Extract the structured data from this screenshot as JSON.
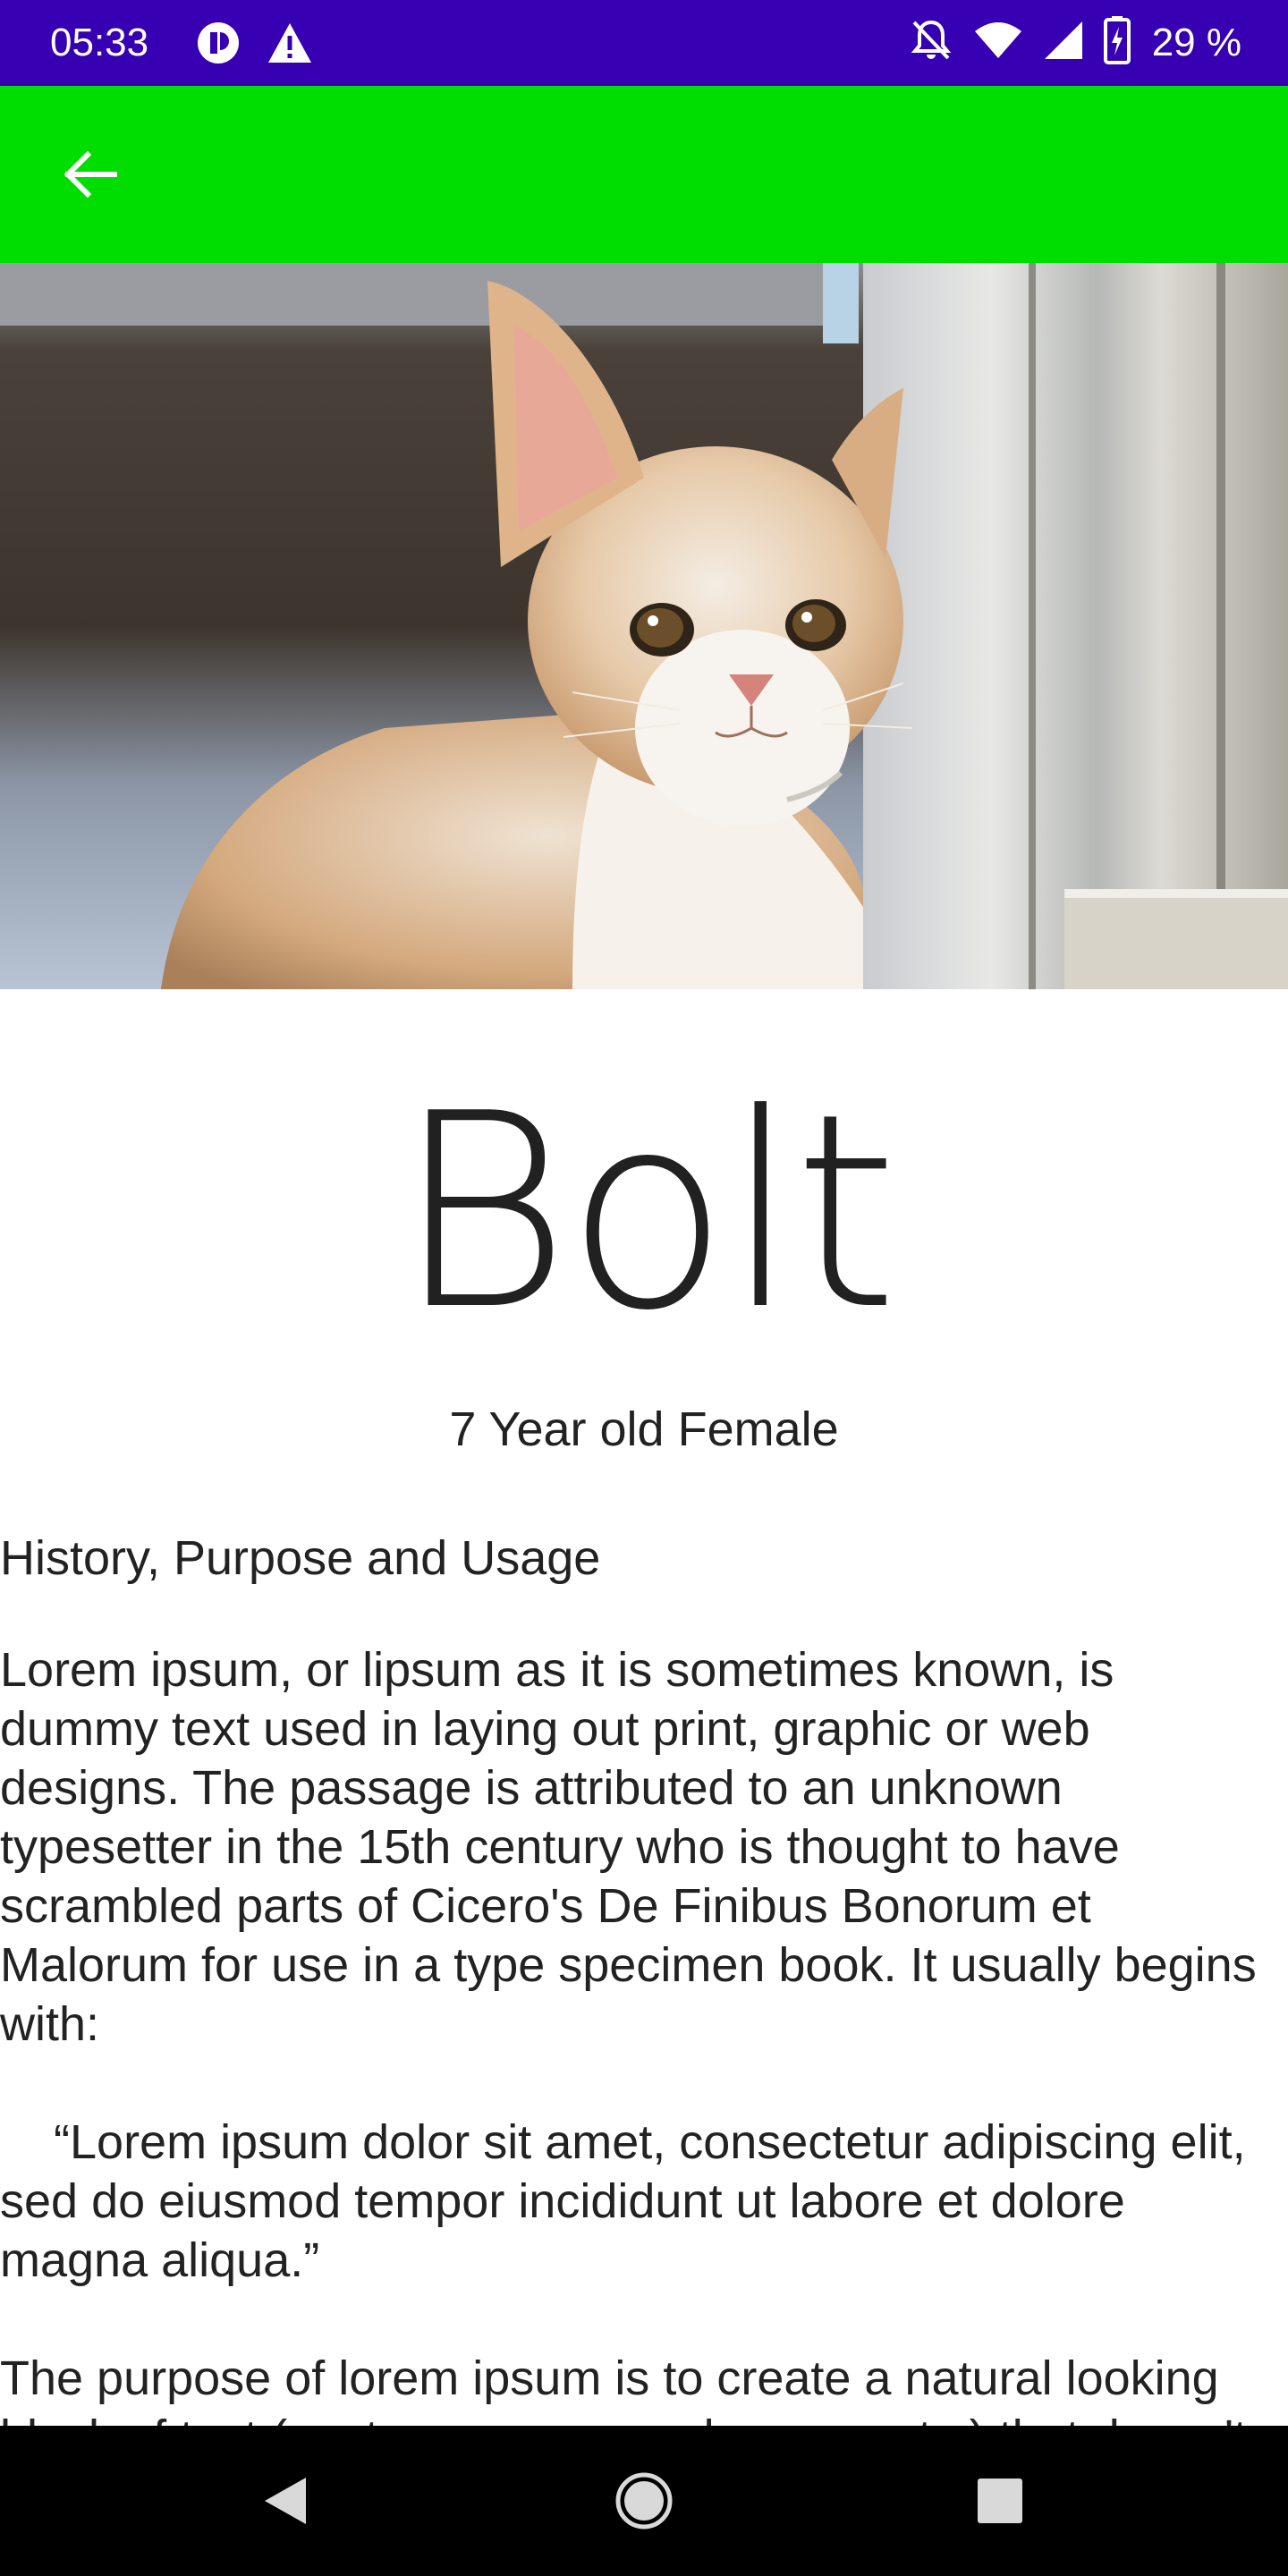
{
  "status_bar": {
    "time": "05:33",
    "battery": "29 %",
    "icons": [
      "tracking-icon",
      "alert-icon",
      "mute-icon",
      "wifi-icon",
      "signal-icon",
      "battery-icon"
    ]
  },
  "app_bar": {
    "background": "#00dd00",
    "back_icon": "arrow-left-icon"
  },
  "hero": {
    "subject": "kitten-photo"
  },
  "pet": {
    "name": "Bolt",
    "subtitle": "7 Year old Female"
  },
  "section": {
    "heading": "History, Purpose and Usage",
    "body": "Lorem ipsum, or lipsum as it is sometimes known, is dummy text used in laying out print, graphic or web designs. The passage is attributed to an unknown typesetter in the 15th century who is thought to have scrambled parts of Cicero's De Finibus Bonorum et Malorum for use in a type specimen book. It usually begins with:\n\n    “Lorem ipsum dolor sit amet, consectetur adipiscing elit, sed do eiusmod tempor incididunt ut labore et dolore magna aliqua.”\n\nThe purpose of lorem ipsum is to create a natural looking block of text (sentence, paragraph, page, etc.) that doesn't distract from the layout."
  },
  "nav_bar": {
    "icons": [
      "back-triangle-icon",
      "home-circle-icon",
      "recents-square-icon"
    ]
  },
  "colors": {
    "status_bar": "#3700b3",
    "app_bar": "#00dd00",
    "text": "#222222"
  }
}
